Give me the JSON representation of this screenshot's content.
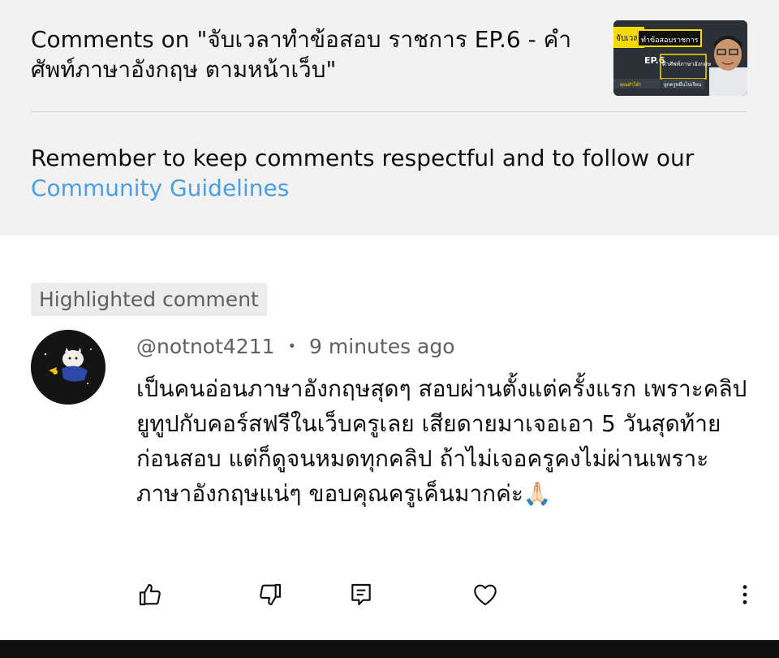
{
  "header": {
    "title": "Comments on \"จับเวลาทำข้อสอบ ราชการ EP.6 - คำศัพท์ภาษาอังกฤษ ตามหน้าเว็บ\"",
    "thumbnail": {
      "label_top_left": "จับเวลา",
      "label_top_right": "ทำข้อสอบราชการ",
      "label_ep": "EP.6",
      "label_topic": "คำศัพท์ภาษาอังกฤษ",
      "label_small_left": "คุณทำได้!",
      "label_small_right": "ลูกครูหมื่นไปเรียน"
    }
  },
  "notice": {
    "text": "Remember to keep comments respectful and to follow our",
    "link": "Community Guidelines"
  },
  "comment": {
    "badge": "Highlighted comment",
    "author": "@notnot4211",
    "separator": "•",
    "time": "9 minutes ago",
    "text": "เป็นคนอ่อนภาษาอังกฤษสุดๆ สอบผ่านตั้งแต่ครั้งแรก เพราะคลิปยูทูปกับคอร์สฟรีในเว็บครูเลย เสียดายมาเจอเอา 5 วันสุดท้ายก่อนสอบ แต่ก็ดูจนหมดทุกคลิป ถ้าไม่เจอครูคงไม่ผ่านเพราะภาษาอังกฤษแน่ๆ ขอบคุณครูเค็นมากค่ะ🙏🏻"
  },
  "actions": [
    {
      "icon": "thumbs-up-icon"
    },
    {
      "icon": "thumbs-down-icon"
    },
    {
      "icon": "reply-icon"
    },
    {
      "icon": "heart-icon"
    },
    {
      "icon": "more-vert-icon"
    }
  ],
  "colors": {
    "header_bg": "#f2f2f2",
    "link": "#4a9ee8",
    "meta_text": "#606060",
    "thumb_yellow": "#f5d90a"
  }
}
